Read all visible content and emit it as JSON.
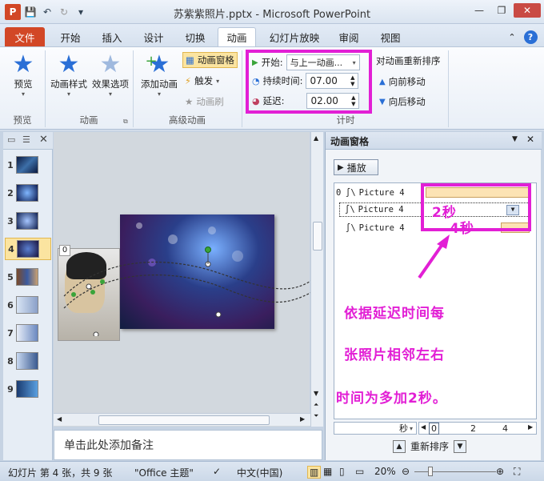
{
  "window": {
    "title": "苏紫紫照片.pptx - Microsoft PowerPoint"
  },
  "tabs": [
    "文件",
    "开始",
    "插入",
    "设计",
    "切换",
    "动画",
    "幻灯片放映",
    "审阅",
    "视图"
  ],
  "ribbon": {
    "preview": {
      "label": "预览",
      "group": "预览"
    },
    "animation": {
      "styles": "动画样式",
      "effects": "效果选项",
      "group": "动画"
    },
    "advanced": {
      "add": "添加动画",
      "pane": "动画窗格",
      "trigger": "触发",
      "painter": "动画刷",
      "group": "高级动画"
    },
    "timing": {
      "start_label": "开始:",
      "start_value": "与上一动画...",
      "duration_label": "持续时间:",
      "duration_value": "07.00",
      "delay_label": "延迟:",
      "delay_value": "02.00",
      "group": "计时"
    },
    "reorder": {
      "title": "对动画重新排序",
      "forward": "向前移动",
      "backward": "向后移动"
    }
  },
  "slides": [
    "1",
    "2",
    "3",
    "4",
    "5",
    "6",
    "7",
    "8",
    "9"
  ],
  "slide_tag": "0",
  "notes": {
    "placeholder": "单击此处添加备注"
  },
  "anim_pane": {
    "title": "动画窗格",
    "play": "播放",
    "items": [
      {
        "index": "0",
        "name": "Picture 4"
      },
      {
        "index": "",
        "name": "Picture 4"
      },
      {
        "index": "",
        "name": "Picture 4"
      }
    ],
    "annotations": {
      "two_sec": "2秒",
      "four_sec": "4秒",
      "note_l1": "依据延迟时间每",
      "note_l2": "张照片相邻左右",
      "note_l3": "时间为多加2秒。"
    },
    "timeline": {
      "unit": "秒",
      "ticks": [
        "0",
        "2",
        "4"
      ]
    },
    "reorder": "重新排序"
  },
  "status": {
    "slide_info": "幻灯片 第 4 张，共 9 张",
    "theme": "\"Office 主题\"",
    "language": "中文(中国)",
    "zoom": "20%"
  },
  "colors": {
    "accent": "#2a6fd6",
    "file_tab": "#d24726",
    "annotation": "#e21fd5",
    "timing_bar": "#fce3b4"
  }
}
